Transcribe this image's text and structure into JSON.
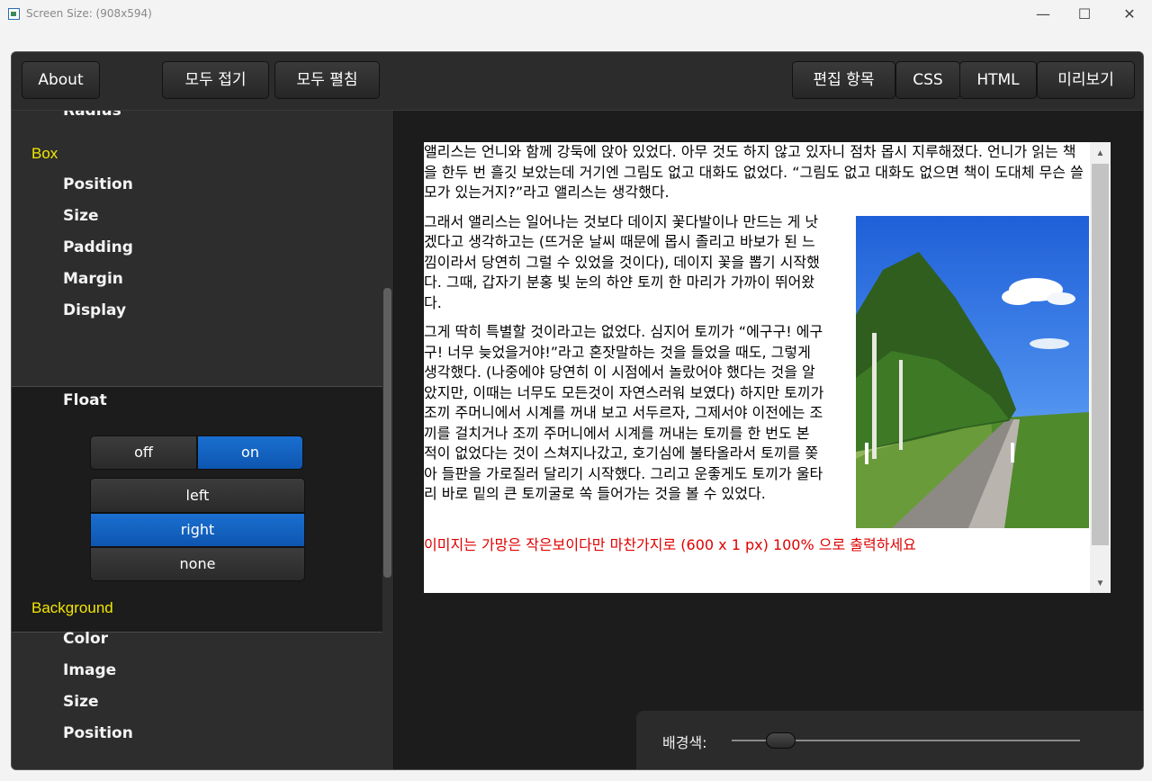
{
  "window": {
    "title": "Screen Size: (908x594)",
    "controls": {
      "minimize": "—",
      "maximize": "☐",
      "close": "✕"
    }
  },
  "toolbar": {
    "about": "About",
    "collapse_all": "모두 접기",
    "expand_all": "모두 펼침",
    "tabs": [
      {
        "label": "편집 항목",
        "active": false
      },
      {
        "label": "CSS",
        "active": false
      },
      {
        "label": "HTML",
        "active": false
      },
      {
        "label": "미리보기",
        "active": true
      }
    ]
  },
  "sidebar": {
    "cut_item": "Radius",
    "box": {
      "heading": "Box",
      "items": [
        "Position",
        "Size",
        "Padding",
        "Margin",
        "Display",
        "Float"
      ]
    },
    "float_controls": {
      "toggle": [
        {
          "label": "off",
          "active": false
        },
        {
          "label": "on",
          "active": true
        }
      ],
      "options": [
        {
          "label": "left",
          "active": false
        },
        {
          "label": "right",
          "active": true
        },
        {
          "label": "none",
          "active": false
        }
      ]
    },
    "background": {
      "heading": "Background",
      "items": [
        "Color",
        "Image",
        "Size",
        "Position"
      ]
    }
  },
  "preview": {
    "paragraphs": [
      "앨리스는 언니와 함께 강둑에 앉아 있었다. 아무 것도 하지 않고 있자니 점차 몹시 지루해졌다. 언니가 읽는 책을 한두 번 흘깃 보았는데 거기엔 그림도 없고 대화도 없었다. “그림도 없고 대화도 없으면 책이 도대체 무슨 쓸모가 있는거지?”라고 앨리스는 생각했다.",
      "그래서 앨리스는 일어나는 것보다 데이지 꽃다발이나 만드는 게 낫겠다고 생각하고는 (뜨거운 날씨 때문에 몹시 졸리고 바보가 된 느낌이라서 당연히 그럴 수 있었을 것이다), 데이지 꽃을 뽑기 시작했다. 그때, 갑자기 분홍 빛 눈의 하얀 토끼 한 마리가 가까이 뛰어왔다.",
      "그게 딱히 특별할 것이라고는 없었다. 심지어 토끼가 “에구구! 에구구! 너무 늦었을거야!”라고 혼잣말하는 것을 들었을 때도, 그렇게 생각했다. (나중에야 당연히 이 시점에서 놀랐어야 했다는 것을 알았지만, 이때는 너무도 모든것이 자연스러워 보였다) 하지만 토끼가 조끼 주머니에서 시계를 꺼내 보고 서두르자, 그제서야 이전에는 조끼를 걸치거나 조끼 주머니에서 시계를 꺼내는 토끼를 한 번도 본 적이 없었다는 것이 스쳐지나갔고, 호기심에 불타올라서 토끼를 쫒아 들판을 가로질러 달리기 시작했다. 그리고 운좋게도 토끼가 울타리 바로 밑의 큰 토끼굴로 쏙 들어가는 것을 볼 수 있었다."
    ],
    "cut_line": "이미지는 가망은 작은보이다만 마찬가지로 (600 x 1 px) 100% 으로 출력하세요",
    "cut_color": "#e00000",
    "image_icon": "tree-lined-road-photo"
  },
  "bottom": {
    "label": "배경색:",
    "slider_value": 0.12
  },
  "colors": {
    "accent": "#1565c8",
    "heading": "#f2e600",
    "background": "#1f1f1f"
  }
}
